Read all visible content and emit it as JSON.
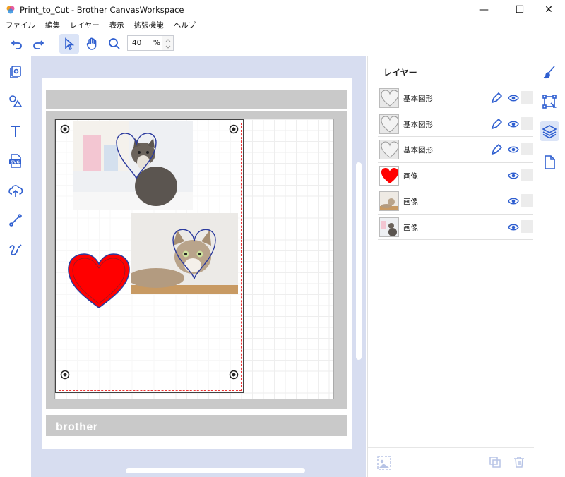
{
  "window": {
    "title": "Print_to_Cut - Brother CanvasWorkspace",
    "minimize": "—",
    "maximize": "☐",
    "close": "✕"
  },
  "menu": [
    "ファイル",
    "編集",
    "レイヤー",
    "表示",
    "拡張機能",
    "ヘルプ"
  ],
  "toolbar": {
    "zoom_value": "40",
    "zoom_unit": "%"
  },
  "canvas": {
    "mat_brand": "brother"
  },
  "layers_panel": {
    "title": "レイヤー",
    "rows": [
      {
        "name": "基本図形",
        "thumb": "heart-outline"
      },
      {
        "name": "基本図形",
        "thumb": "heart-outline"
      },
      {
        "name": "基本図形",
        "thumb": "heart-outline"
      },
      {
        "name": "画像",
        "thumb": "red-heart"
      },
      {
        "name": "画像",
        "thumb": "cat-photo"
      },
      {
        "name": "画像",
        "thumb": "cat-photo"
      }
    ]
  },
  "colors": {
    "accent": "#2f5fd0",
    "canvas_bg": "#d7ddf0",
    "heart_red": "#ff0000",
    "heart_stroke": "#2b3a9e",
    "cut_line": "#e33333"
  }
}
